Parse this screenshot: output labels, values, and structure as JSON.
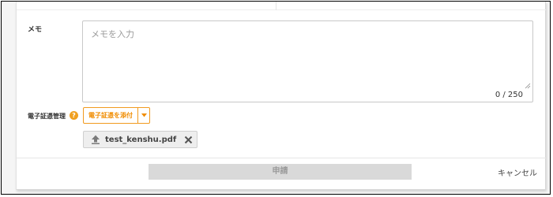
{
  "memo": {
    "label": "メモ",
    "placeholder": "メモを入力",
    "value": "",
    "counter": "0 / 250"
  },
  "certificate": {
    "label": "電子証憑管理",
    "help_icon": "question-circle-icon",
    "help_glyph": "?",
    "attach_label": "電子証憑を添付",
    "attach_menu_icon": "caret-down-icon",
    "file": {
      "name": "test_kenshu.pdf",
      "icon": "upload-arrow-icon",
      "remove_icon": "close-icon"
    }
  },
  "footer": {
    "submit_label": "申請",
    "cancel_label": "キャンセル"
  },
  "colors": {
    "accent": "#f08c00",
    "help_icon": "#f0a020",
    "submit_disabled_bg": "#d9d9d9",
    "submit_disabled_text": "#9a9a9a"
  }
}
